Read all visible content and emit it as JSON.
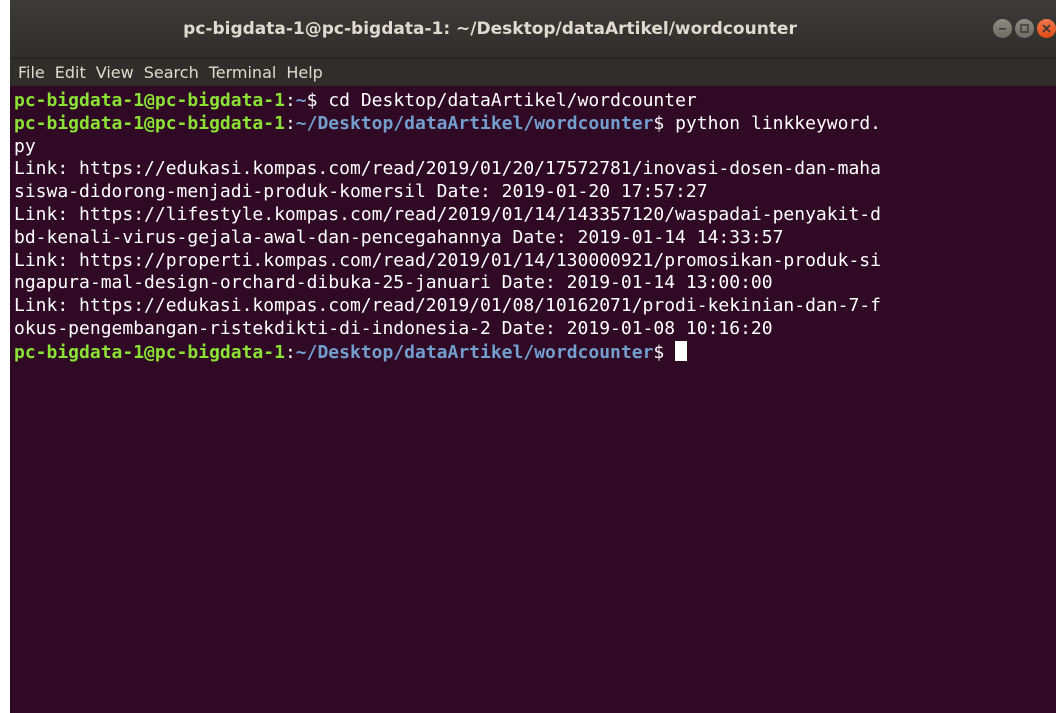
{
  "window": {
    "title": "pc-bigdata-1@pc-bigdata-1: ~/Desktop/dataArtikel/wordcounter",
    "controls": {
      "minimize_icon": "minimize-icon",
      "maximize_icon": "maximize-icon",
      "close_icon": "close-icon"
    }
  },
  "menu": [
    "File",
    "Edit",
    "View",
    "Search",
    "Terminal",
    "Help"
  ],
  "terminal": {
    "lines": [
      {
        "user": "pc-bigdata-1@pc-bigdata-1",
        "colon": ":",
        "path": "~",
        "dollar": "$ ",
        "cmd": "cd Desktop/dataArtikel/wordcounter"
      },
      {
        "user": "pc-bigdata-1@pc-bigdata-1",
        "colon": ":",
        "path": "~/Desktop/dataArtikel/wordcounter",
        "dollar": "$ ",
        "cmd": "python linkkeyword."
      },
      {
        "text": "py"
      },
      {
        "text": "Link: https://edukasi.kompas.com/read/2019/01/20/17572781/inovasi-dosen-dan-maha"
      },
      {
        "text": "siswa-didorong-menjadi-produk-komersil Date: 2019-01-20 17:57:27"
      },
      {
        "text": "Link: https://lifestyle.kompas.com/read/2019/01/14/143357120/waspadai-penyakit-d"
      },
      {
        "text": "bd-kenali-virus-gejala-awal-dan-pencegahannya Date: 2019-01-14 14:33:57"
      },
      {
        "text": "Link: https://properti.kompas.com/read/2019/01/14/130000921/promosikan-produk-si"
      },
      {
        "text": "ngapura-mal-design-orchard-dibuka-25-januari Date: 2019-01-14 13:00:00"
      },
      {
        "text": "Link: https://edukasi.kompas.com/read/2019/01/08/10162071/prodi-kekinian-dan-7-f"
      },
      {
        "text": "okus-pengembangan-ristekdikti-di-indonesia-2 Date: 2019-01-08 10:16:20"
      },
      {
        "user": "pc-bigdata-1@pc-bigdata-1",
        "colon": ":",
        "path": "~/Desktop/dataArtikel/wordcounter",
        "dollar": "$ ",
        "cmd": ""
      }
    ]
  },
  "colors": {
    "background": "#300a24",
    "prompt_user": "#8ae234",
    "prompt_path": "#729fcf",
    "close_button": "#df4b16"
  }
}
